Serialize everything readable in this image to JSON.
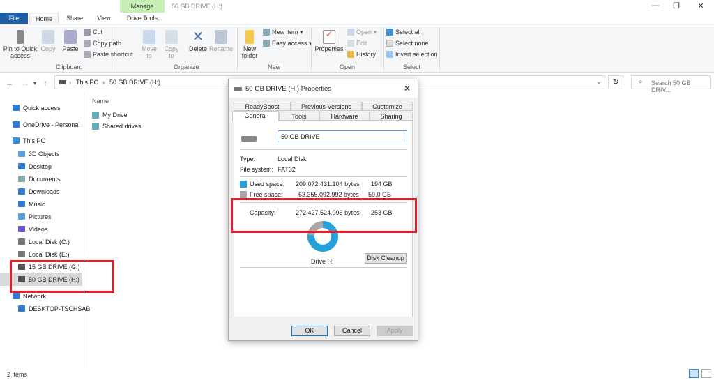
{
  "window": {
    "title": "50 GB DRIVE (H:)",
    "context_tab": "Manage",
    "min": "—",
    "max": "❐",
    "close": "✕"
  },
  "tabs": [
    "File",
    "Home",
    "Share",
    "View",
    "Drive Tools"
  ],
  "ribbon": {
    "clipboard": {
      "pin": "Pin to Quick access",
      "copy": "Copy",
      "paste": "Paste",
      "cut": "Cut",
      "copy_path": "Copy path",
      "paste_shortcut": "Paste shortcut",
      "label": "Clipboard"
    },
    "organize": {
      "move_to": "Move to",
      "copy_to": "Copy to",
      "delete": "Delete",
      "rename": "Rename",
      "label": "Organize"
    },
    "new": {
      "new_folder": "New folder",
      "new_item": "New item ▾",
      "easy_access": "Easy access ▾",
      "label": "New"
    },
    "open": {
      "properties": "Properties",
      "open": "Open ▾",
      "edit": "Edit",
      "history": "History",
      "label": "Open"
    },
    "select": {
      "select_all": "Select all",
      "select_none": "Select none",
      "invert": "Invert selection",
      "label": "Select"
    }
  },
  "address": {
    "crumbs": [
      "This PC",
      "50 GB DRIVE (H:)"
    ],
    "search_placeholder": "Search 50 GB DRIV..."
  },
  "sidebar": [
    {
      "label": "Quick access",
      "color": "#2b7cd3"
    },
    {
      "label": "OneDrive - Personal",
      "color": "#2b7cd3"
    },
    {
      "label": "This PC",
      "color": "#3a8fd8"
    },
    {
      "label": "3D Objects",
      "color": "#5aa0e0"
    },
    {
      "label": "Desktop",
      "color": "#2b7cd3"
    },
    {
      "label": "Documents",
      "color": "#8aa"
    },
    {
      "label": "Downloads",
      "color": "#2b7cd3"
    },
    {
      "label": "Music",
      "color": "#2b7cd3"
    },
    {
      "label": "Pictures",
      "color": "#5aa0e0"
    },
    {
      "label": "Videos",
      "color": "#6a5acd"
    },
    {
      "label": "Local Disk (C:)",
      "color": "#777"
    },
    {
      "label": "Local Disk (E:)",
      "color": "#777"
    },
    {
      "label": "15 GB DRIVE (G:)",
      "color": "#555"
    },
    {
      "label": "50 GB DRIVE (H:)",
      "color": "#555"
    },
    {
      "label": "Network",
      "color": "#2b7cd3"
    },
    {
      "label": "DESKTOP-TSCHSAB",
      "color": "#2b7cd3"
    }
  ],
  "content": {
    "column": "Name",
    "items": [
      "My Drive",
      "Shared drives"
    ]
  },
  "status": "2 items",
  "dialog": {
    "title": "50 GB DRIVE (H:) Properties",
    "close": "✕",
    "tabs_back": [
      "ReadyBoost",
      "Previous Versions",
      "Customize"
    ],
    "tabs_front": [
      "General",
      "Tools",
      "Hardware",
      "Sharing"
    ],
    "name": "50 GB DRIVE",
    "type_label": "Type:",
    "type": "Local Disk",
    "fs_label": "File system:",
    "fs": "FAT32",
    "used_label": "Used space:",
    "used_bytes": "209.072.431.104 bytes",
    "used_gb": "194 GB",
    "free_label": "Free space:",
    "free_bytes": "63.355.092.992 bytes",
    "free_gb": "59,0 GB",
    "cap_label": "Capacity:",
    "cap_bytes": "272.427.524.096 bytes",
    "cap_gb": "253 GB",
    "used_fraction": 0.767,
    "used_color": "#26a0da",
    "free_color": "#a8a8a8",
    "drive_label": "Drive H:",
    "cleanup": "Disk Cleanup",
    "ok": "OK",
    "cancel": "Cancel",
    "apply": "Apply"
  }
}
